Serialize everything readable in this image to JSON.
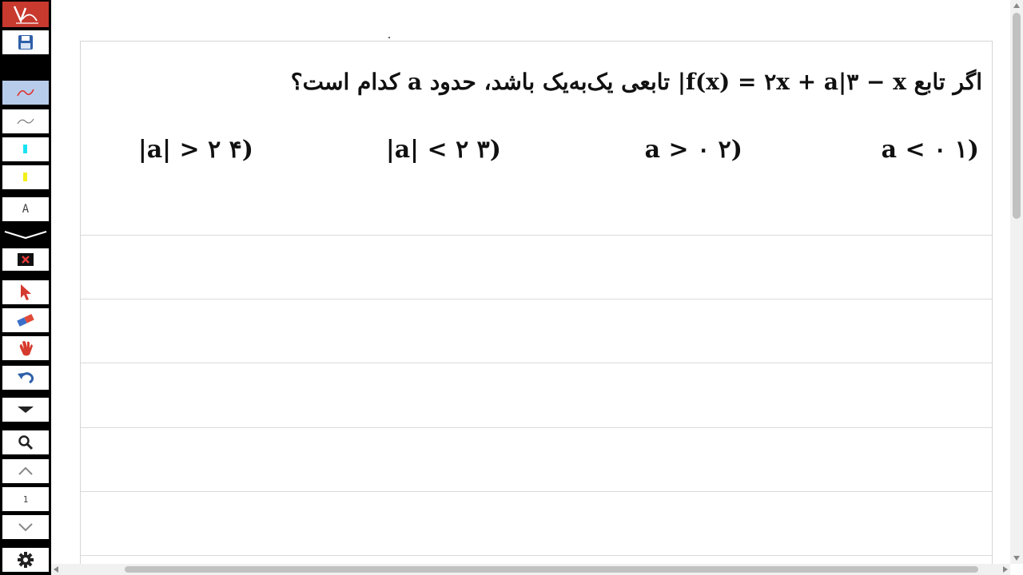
{
  "toolbar": {
    "items": [
      {
        "name": "app-logo-icon"
      },
      {
        "name": "save-icon"
      },
      {
        "name": "pen-red-icon",
        "active": true
      },
      {
        "name": "pen-thin-icon"
      },
      {
        "name": "highlighter-cyan-icon",
        "color": "#19e3f2"
      },
      {
        "name": "highlighter-yellow-icon",
        "color": "#f2ef19"
      },
      {
        "name": "text-tool-icon",
        "label": "A"
      },
      {
        "name": "collapse-chevron-icon"
      },
      {
        "name": "clear-icon"
      },
      {
        "name": "pointer-icon"
      },
      {
        "name": "eraser-icon"
      },
      {
        "name": "hand-icon"
      },
      {
        "name": "undo-icon"
      },
      {
        "name": "dropdown-icon"
      },
      {
        "name": "zoom-icon"
      },
      {
        "name": "page-up-icon"
      },
      {
        "name": "page-number",
        "label": "1"
      },
      {
        "name": "page-down-icon"
      },
      {
        "name": "settings-icon"
      }
    ],
    "text_tool_label": "A",
    "page_number": "1"
  },
  "colors": {
    "logo_bg": "#c8392e",
    "active_tool_bg": "#b7ccea",
    "toolbar_bg": "#000000"
  },
  "question": {
    "text": "اگر تابع f(x) = ۲x + a|۳ − x| تابعی یک‌به‌یک باشد، حدود a کدام است؟",
    "options": [
      {
        "number": "(۱",
        "expr": "a < ۰"
      },
      {
        "number": "(۲",
        "expr": "a > ۰"
      },
      {
        "number": "(۳",
        "expr": "|a| < ۲"
      },
      {
        "number": "(۴",
        "expr": "|a| > ۲"
      }
    ]
  }
}
